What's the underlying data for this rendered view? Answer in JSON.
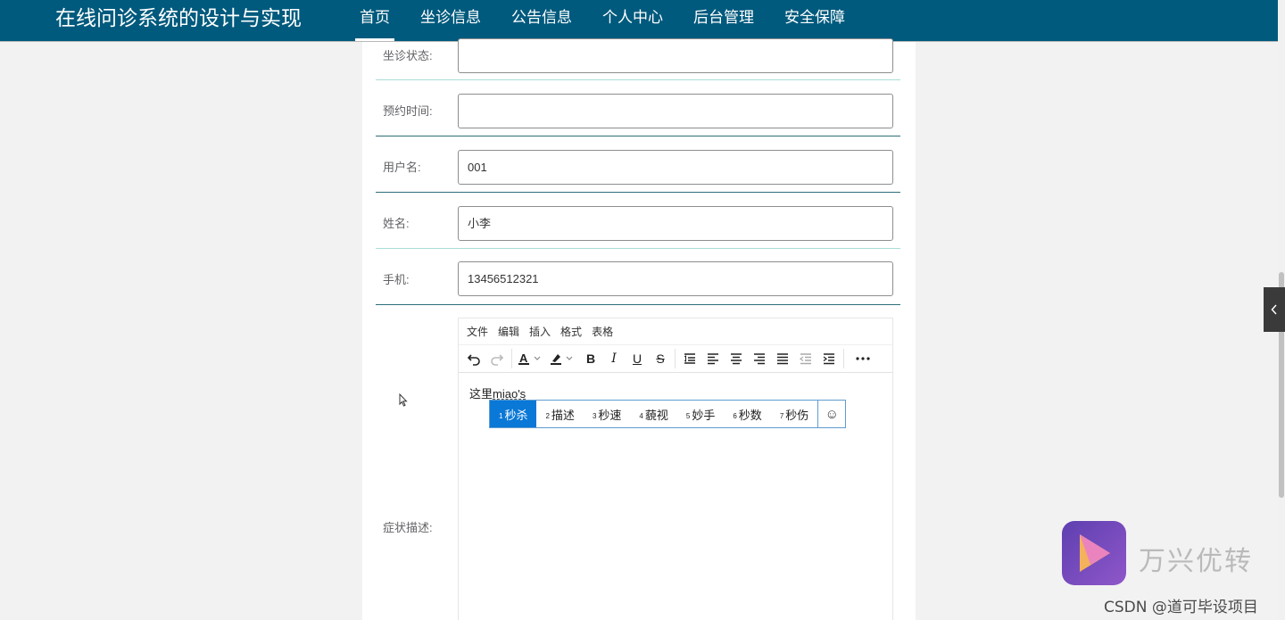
{
  "header": {
    "site_title": "在线问诊系统的设计与实现",
    "nav": [
      "首页",
      "坐诊信息",
      "公告信息",
      "个人中心",
      "后台管理",
      "安全保障"
    ],
    "active_nav": "首页"
  },
  "form": {
    "rows": [
      {
        "label": "坐诊状态:",
        "value": ""
      },
      {
        "label": "预约时间:",
        "value": ""
      },
      {
        "label": "用户名:",
        "value": "001"
      },
      {
        "label": "姓名:",
        "value": "小李"
      },
      {
        "label": "手机:",
        "value": "13456512321"
      }
    ],
    "symptom_label": "症状描述:"
  },
  "editor": {
    "menu": [
      "文件",
      "编辑",
      "插入",
      "格式",
      "表格"
    ],
    "content_prefix": "这里",
    "content_typing": "miao's"
  },
  "ime": {
    "candidates": [
      {
        "num": "1",
        "text": "秒杀"
      },
      {
        "num": "2",
        "text": "描述"
      },
      {
        "num": "3",
        "text": "秒速"
      },
      {
        "num": "4",
        "text": "藐视"
      },
      {
        "num": "5",
        "text": "妙手"
      },
      {
        "num": "6",
        "text": "秒数"
      },
      {
        "num": "7",
        "text": "秒伤"
      }
    ],
    "selected_index": 0,
    "emoji": "☺"
  },
  "watermark": {
    "brand": "万兴优转",
    "csdn": "CSDN @道可毕设项目"
  },
  "colors": {
    "header_bg": "#005a7d",
    "ime_selected": "#0a78d7"
  }
}
